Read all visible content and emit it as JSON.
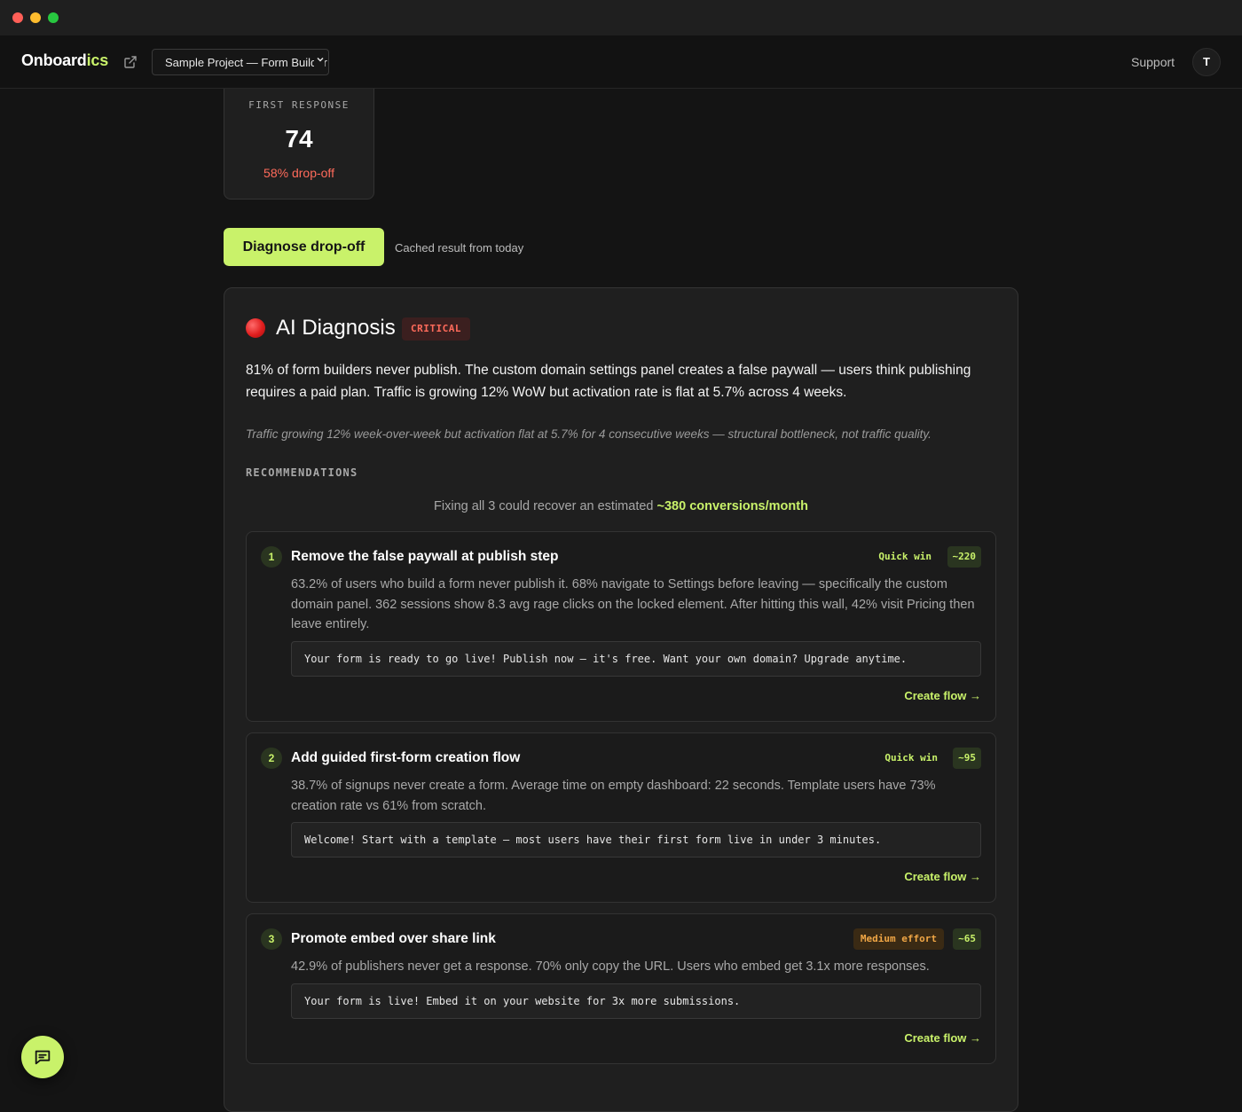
{
  "app": {
    "logo_main": "Onboard",
    "logo_accent": "ics",
    "project_selector": "Sample Project — Form Builder",
    "support_label": "Support",
    "avatar_initial": "T"
  },
  "metric": {
    "label": "FIRST RESPONSE",
    "value": "74",
    "dropoff": "58% drop-off"
  },
  "actions": {
    "diagnose_label": "Diagnose drop-off",
    "cached_note": "Cached result from today"
  },
  "diagnosis": {
    "title": "AI Diagnosis",
    "severity": "CRITICAL",
    "summary": "81% of form builders never publish. The custom domain settings panel creates a false paywall — users think publishing requires a paid plan. Traffic is growing 12% WoW but activation rate is flat at 5.7% across 4 weeks.",
    "evidence": "Traffic growing 12% week-over-week but activation flat at 5.7% for 4 consecutive weeks — structural bottleneck, not traffic quality.",
    "recommendations_heading": "RECOMMENDATIONS",
    "recovery_prefix": "Fixing all 3 could recover an estimated ",
    "recovery_value": "~380 conversions/month",
    "recommendations": [
      {
        "number": "1",
        "title": "Remove the false paywall at publish step",
        "effort": "Quick win",
        "impact": "~220",
        "description": "63.2% of users who build a form never publish it. 68% navigate to Settings before leaving — specifically the custom domain panel. 362 sessions show 8.3 avg rage clicks on the locked element. After hitting this wall, 42% visit Pricing then leave entirely.",
        "copy": "Your form is ready to go live! Publish now — it's free. Want your own domain? Upgrade anytime.",
        "cta": "Create flow →"
      },
      {
        "number": "2",
        "title": "Add guided first-form creation flow",
        "effort": "Quick win",
        "impact": "~95",
        "description": "38.7% of signups never create a form. Average time on empty dashboard: 22 seconds. Template users have 73% creation rate vs 61% from scratch.",
        "copy": "Welcome! Start with a template — most users have their first form live in under 3 minutes.",
        "cta": "Create flow →"
      },
      {
        "number": "3",
        "title": "Promote embed over share link",
        "effort": "Medium effort",
        "impact": "~65",
        "description": "42.9% of publishers never get a response. 70% only copy the URL. Users who embed get 3.1x more responses.",
        "copy": "Your form is live! Embed it on your website for 3x more submissions.",
        "cta": "Create flow →"
      }
    ]
  },
  "colors": {
    "accent": "#c9f26a",
    "critical": "#ff6b5b",
    "medium_effort": "#f0a645",
    "background": "#141414",
    "card": "#1f1f1f"
  },
  "icons": {
    "external_link": "external-link-icon",
    "chevron": "chevron-down-icon",
    "status": "red-circle-icon",
    "chat": "chat-bubble-icon"
  }
}
